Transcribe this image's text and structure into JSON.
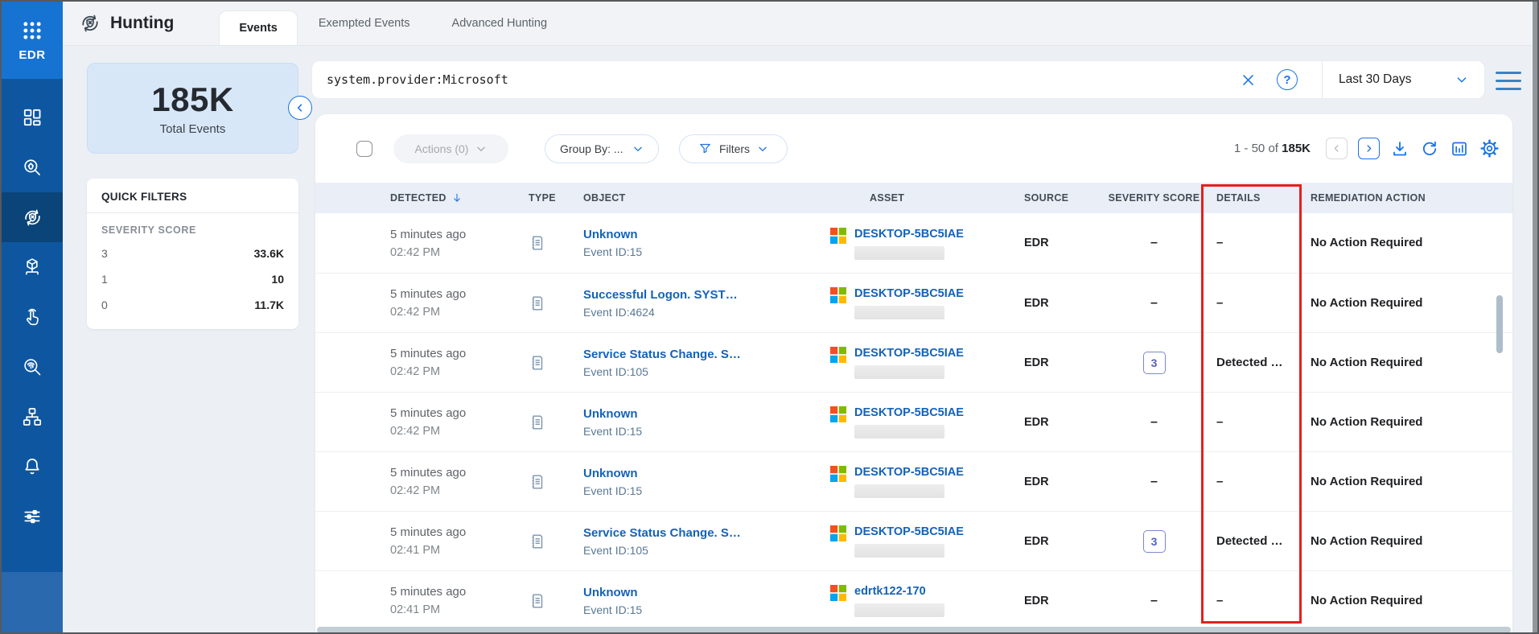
{
  "colors": {
    "accent": "#1a73e8",
    "sidebar": "#0e57a0",
    "sidebar_top": "#1673d2",
    "sidebar_active": "#0a4478",
    "link_blue": "#1462ba",
    "annotation_red": "#e5201d",
    "severity_badge": "#5c6bc0"
  },
  "sidebar": {
    "product_label": "EDR",
    "items": [
      {
        "icon": "apps-grid-icon"
      },
      {
        "icon": "dashboard-icon"
      },
      {
        "icon": "threat-search-icon"
      },
      {
        "icon": "hunting-icon",
        "active": true
      },
      {
        "icon": "assets-icon"
      },
      {
        "icon": "behavior-click-icon"
      },
      {
        "icon": "forensics-search-icon"
      },
      {
        "icon": "topology-icon"
      },
      {
        "icon": "notifications-bell-icon"
      },
      {
        "icon": "preferences-sliders-icon"
      }
    ]
  },
  "header": {
    "title": "Hunting",
    "tabs": [
      {
        "label": "Events",
        "active": true
      },
      {
        "label": "Exempted Events",
        "active": false
      },
      {
        "label": "Advanced Hunting",
        "active": false
      }
    ]
  },
  "summary": {
    "value": "185K",
    "label": "Total Events"
  },
  "quick_filters": {
    "title": "QUICK FILTERS",
    "section_title": "SEVERITY SCORE",
    "rows": [
      {
        "label": "3",
        "value": "33.6K"
      },
      {
        "label": "1",
        "value": "10"
      },
      {
        "label": "0",
        "value": "11.7K"
      }
    ]
  },
  "search": {
    "query": "system.provider:Microsoft",
    "time_range": "Last 30 Days",
    "icons": [
      "clear-x-icon",
      "help-icon",
      "chevron-down-icon",
      "menu-hamburger-icon"
    ]
  },
  "toolbar": {
    "actions_label": "Actions (0)",
    "group_by_label": "Group By: ...",
    "filters_label": "Filters",
    "pagination_range": "1 - 50 of",
    "pagination_total": "185K",
    "icons": [
      "prev-page-icon",
      "next-page-icon",
      "download-icon",
      "refresh-icon",
      "chart-icon",
      "settings-gear-icon"
    ]
  },
  "table": {
    "columns": [
      "DETECTED",
      "TYPE",
      "OBJECT",
      "ASSET",
      "SOURCE",
      "SEVERITY SCORE",
      "DETAILS",
      "REMEDIATION ACTION"
    ],
    "sort_column": "DETECTED",
    "type_icon": "event-log-icon",
    "asset_icon": "microsoft-windows-logo",
    "rows": [
      {
        "detected_rel": "5 minutes ago",
        "detected_time": "02:42 PM",
        "object": "Unknown",
        "object_sub": "Event ID:15",
        "asset": "DESKTOP-5BC5IAE",
        "source": "EDR",
        "severity": "–",
        "details": "–",
        "remediation": "No Action Required"
      },
      {
        "detected_rel": "5 minutes ago",
        "detected_time": "02:42 PM",
        "object": "Successful Logon. SYST…",
        "object_sub": "Event ID:4624",
        "asset": "DESKTOP-5BC5IAE",
        "source": "EDR",
        "severity": "–",
        "details": "–",
        "remediation": "No Action Required"
      },
      {
        "detected_rel": "5 minutes ago",
        "detected_time": "02:42 PM",
        "object": "Service Status Change. S…",
        "object_sub": "Event ID:105",
        "asset": "DESKTOP-5BC5IAE",
        "source": "EDR",
        "severity": "3",
        "details": "Detected …",
        "remediation": "No Action Required"
      },
      {
        "detected_rel": "5 minutes ago",
        "detected_time": "02:42 PM",
        "object": "Unknown",
        "object_sub": "Event ID:15",
        "asset": "DESKTOP-5BC5IAE",
        "source": "EDR",
        "severity": "–",
        "details": "–",
        "remediation": "No Action Required"
      },
      {
        "detected_rel": "5 minutes ago",
        "detected_time": "02:42 PM",
        "object": "Unknown",
        "object_sub": "Event ID:15",
        "asset": "DESKTOP-5BC5IAE",
        "source": "EDR",
        "severity": "–",
        "details": "–",
        "remediation": "No Action Required"
      },
      {
        "detected_rel": "5 minutes ago",
        "detected_time": "02:41 PM",
        "object": "Service Status Change. S…",
        "object_sub": "Event ID:105",
        "asset": "DESKTOP-5BC5IAE",
        "source": "EDR",
        "severity": "3",
        "details": "Detected …",
        "remediation": "No Action Required"
      },
      {
        "detected_rel": "5 minutes ago",
        "detected_time": "02:41 PM",
        "object": "Unknown",
        "object_sub": "Event ID:15",
        "asset": "edrtk122-170",
        "source": "EDR",
        "severity": "–",
        "details": "–",
        "remediation": "No Action Required"
      }
    ]
  },
  "annotation": {
    "highlighted_column": "DETAILS",
    "color": "#e5201d"
  }
}
